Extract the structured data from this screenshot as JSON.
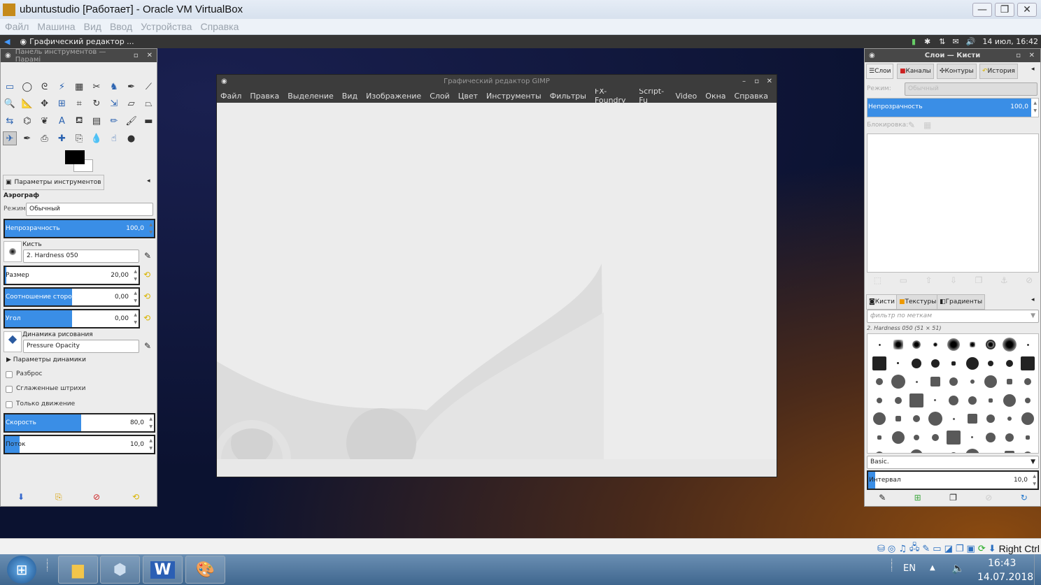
{
  "vbox": {
    "title": "ubuntustudio [Работает] - Oracle VM VirtualBox",
    "menu": [
      "Файл",
      "Машина",
      "Вид",
      "Ввод",
      "Устройства",
      "Справка"
    ],
    "host_key": "Right Ctrl"
  },
  "guest_panel": {
    "task": "Графический редактор ...",
    "clock": "14 июл, 16:42"
  },
  "toolbox": {
    "title": "Панель инструментов — Парамі",
    "tools": [
      "rect-select",
      "ellipse-select",
      "free-select",
      "fuzzy-select",
      "color-select",
      "scissors",
      "foreground-select",
      "paths",
      "color-picker",
      "zoom",
      "measure",
      "move",
      "align",
      "crop",
      "rotate",
      "scale",
      "shear",
      "perspective",
      "flip",
      "cage",
      "warp",
      "text",
      "bucket-fill",
      "blend",
      "pencil",
      "paintbrush",
      "eraser",
      "airbrush",
      "ink",
      "clone",
      "heal",
      "perspective-clone",
      "blur",
      "smudge",
      "dodge"
    ],
    "options_tab": "Параметры инструментов",
    "tool_name": "Аэрограф",
    "mode_label": "Режим:",
    "mode_value": "Обычный",
    "opacity": {
      "label": "Непрозрачность",
      "value": "100,0",
      "fill": 1.0
    },
    "brush_label": "Кисть",
    "brush_value": "2. Hardness 050",
    "size": {
      "label": "Размер",
      "value": "20,00",
      "fill": 0.01
    },
    "aspect": {
      "label": "Соотношение сторон",
      "value": "0,00",
      "fill": 0.5
    },
    "angle": {
      "label": "Угол",
      "value": "0,00",
      "fill": 0.5
    },
    "dynamics_label": "Динамика рисования",
    "dynamics_value": "Pressure Opacity",
    "dynamics_options": "Параметры динамики",
    "checks": [
      "Разброс",
      "Сглаженные штрихи",
      "Только движение"
    ],
    "rate": {
      "label": "Скорость",
      "value": "80,0",
      "fill": 0.51
    },
    "flow": {
      "label": "Поток",
      "value": "10,0",
      "fill": 0.1
    }
  },
  "gimp": {
    "title": "Графический редактор GIMP",
    "menu": [
      "Файл",
      "Правка",
      "Выделение",
      "Вид",
      "Изображение",
      "Слой",
      "Цвет",
      "Инструменты",
      "Фильтры",
      "FX-Foundry",
      "Script-Fu",
      "Video",
      "Окна",
      "Справка"
    ]
  },
  "right_dock": {
    "title": "Слои — Кисти",
    "tabs": [
      "Слои",
      "Каналы",
      "Контуры",
      "История"
    ],
    "mode_label": "Режим:",
    "mode_value": "Обычный",
    "opacity": {
      "label": "Непрозрачность",
      "value": "100,0",
      "fill": 1.0
    },
    "lock_label": "Блокировка:",
    "brush_tabs": [
      "Кисти",
      "Текстуры",
      "Градиенты"
    ],
    "filter_placeholder": "фильтр по меткам",
    "brush_info": "2. Hardness 050 (51 × 51)",
    "preset": "Basic.",
    "interval": {
      "label": "Интервал",
      "value": "10,0",
      "fill": 0.04
    }
  },
  "taskbar": {
    "lang": "EN",
    "time": "16:43",
    "date": "14.07.2018"
  },
  "colors": {
    "accent": "#3a8ee6"
  }
}
